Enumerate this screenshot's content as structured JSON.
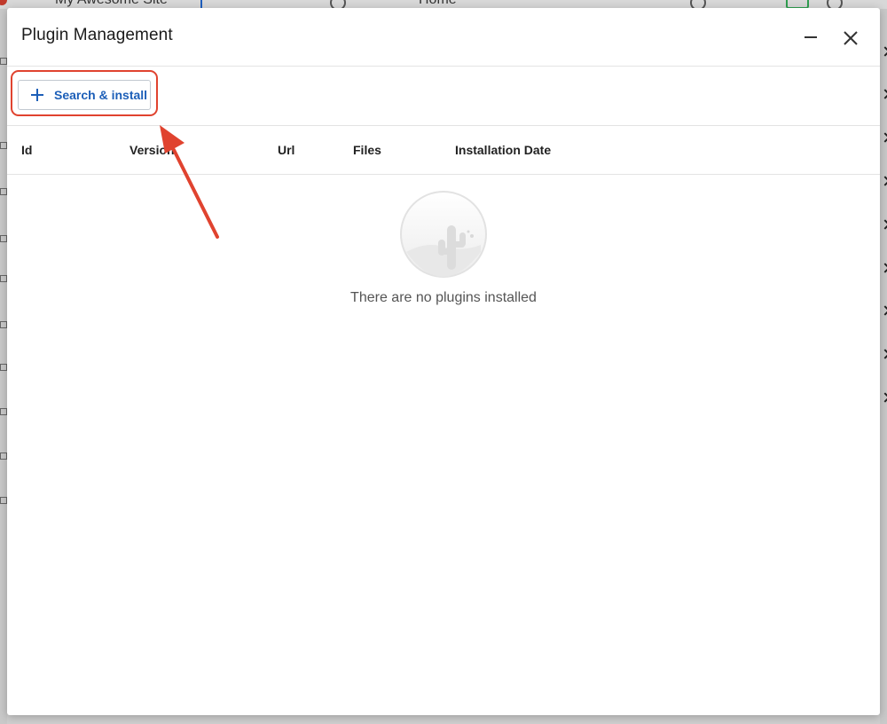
{
  "background": {
    "site_title": "My Awesome Site",
    "home_label": "Home"
  },
  "dialog": {
    "title": "Plugin Management",
    "minimize_icon": "minimize-icon",
    "close_icon": "close-icon"
  },
  "toolbar": {
    "search_install_label": "Search & install",
    "search_install_icon": "plus-icon"
  },
  "table": {
    "columns": [
      "Id",
      "Version",
      "Url",
      "Files",
      "Installation Date"
    ]
  },
  "empty_state": {
    "illustration": "cactus-illustration",
    "message": "There are no plugins installed"
  },
  "annotation": {
    "highlight_color": "#e0432f",
    "arrow_color": "#e0432f"
  },
  "colors": {
    "accent": "#1d5fb8",
    "overlay": "#8a8a8a"
  }
}
